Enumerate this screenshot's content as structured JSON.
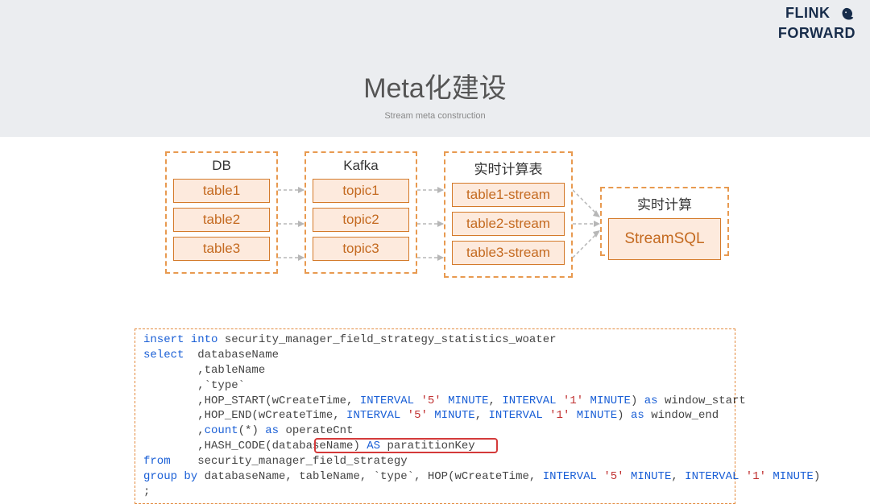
{
  "header": {
    "logo_line1": "FLINK",
    "logo_line2": "FORWARD",
    "title": "Meta化建设",
    "subtitle": "Stream meta construction"
  },
  "diagram": {
    "groups": [
      {
        "title": "DB",
        "nodes": [
          "table1",
          "table2",
          "table3"
        ]
      },
      {
        "title": "Kafka",
        "nodes": [
          "topic1",
          "topic2",
          "topic3"
        ]
      },
      {
        "title": "实时计算表",
        "nodes": [
          "table1-stream",
          "table2-stream",
          "table3-stream"
        ]
      },
      {
        "title": "实时计算",
        "nodes": [
          "StreamSQL"
        ]
      }
    ]
  },
  "code": {
    "l1a": "insert into",
    "l1b": " security_manager_field_strategy_statistics_woater",
    "l2a": "select",
    "l2b": "  databaseName",
    "l3": "        ,tableName",
    "l4": "        ,`type`",
    "l5a": "        ,HOP_START(wCreateTime, ",
    "l5k1": "INTERVAL",
    "l5s1": " '5' ",
    "l5m1": "MINUTE",
    "l5c": ", ",
    "l5k2": "INTERVAL",
    "l5s2": " '1' ",
    "l5m2": "MINUTE",
    "l5d": ") ",
    "l5as": "as",
    "l5e": " window_start",
    "l6a": "        ,HOP_END(wCreateTime, ",
    "l6as": "as",
    "l6e": " window_end",
    "l7a": "        ,",
    "l7c": "count",
    "l7b": "(*) ",
    "l7as": "as",
    "l7e": " operateCnt",
    "l8a": "        ,HASH_CODE(databaseName) ",
    "l8as": "AS",
    "l8e": " paratitionKey",
    "l9a": "from",
    "l9b": "    security_manager_field_strategy",
    "l10a": "group by",
    "l10b": " databaseName, tableName, `type`, HOP(wCreateTime, ",
    "l10e": ")",
    "l11": ";"
  }
}
